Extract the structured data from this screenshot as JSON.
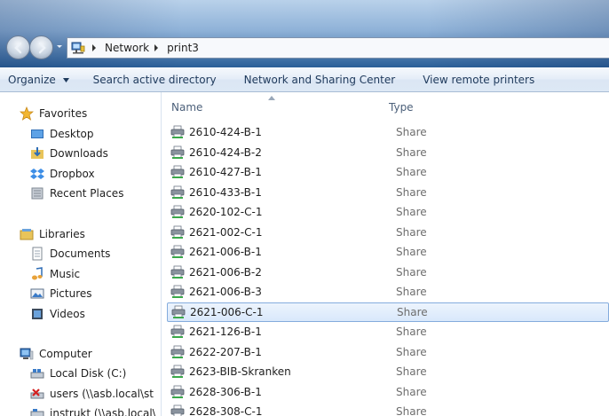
{
  "address": {
    "crumbs": [
      "Network",
      "print3"
    ]
  },
  "toolbar": {
    "organize": "Organize",
    "search_ad": "Search active directory",
    "network_center": "Network and Sharing Center",
    "view_printers": "View remote printers"
  },
  "nav": {
    "favorites": "Favorites",
    "desktop": "Desktop",
    "downloads": "Downloads",
    "dropbox": "Dropbox",
    "recent": "Recent Places",
    "libraries": "Libraries",
    "documents": "Documents",
    "music": "Music",
    "pictures": "Pictures",
    "videos": "Videos",
    "computer": "Computer",
    "local_disk": "Local Disk (C:)",
    "users_share": "users (\\\\asb.local\\st",
    "instrukt_share": "instrukt (\\\\asb.local\\"
  },
  "columns": {
    "name": "Name",
    "type": "Type"
  },
  "files": [
    {
      "name": "2610-424-B-1",
      "type": "Share"
    },
    {
      "name": "2610-424-B-2",
      "type": "Share"
    },
    {
      "name": "2610-427-B-1",
      "type": "Share"
    },
    {
      "name": "2610-433-B-1",
      "type": "Share"
    },
    {
      "name": "2620-102-C-1",
      "type": "Share"
    },
    {
      "name": "2621-002-C-1",
      "type": "Share"
    },
    {
      "name": "2621-006-B-1",
      "type": "Share"
    },
    {
      "name": "2621-006-B-2",
      "type": "Share"
    },
    {
      "name": "2621-006-B-3",
      "type": "Share"
    },
    {
      "name": "2621-006-C-1",
      "type": "Share",
      "selected": true
    },
    {
      "name": "2621-126-B-1",
      "type": "Share"
    },
    {
      "name": "2622-207-B-1",
      "type": "Share"
    },
    {
      "name": "2623-BIB-Skranken",
      "type": "Share"
    },
    {
      "name": "2628-306-B-1",
      "type": "Share"
    },
    {
      "name": "2628-308-C-1",
      "type": "Share"
    }
  ],
  "icons": {
    "back": "arrow-left-icon",
    "forward": "arrow-right-icon",
    "printer": "printer-icon",
    "accent": "#2b5f98"
  }
}
